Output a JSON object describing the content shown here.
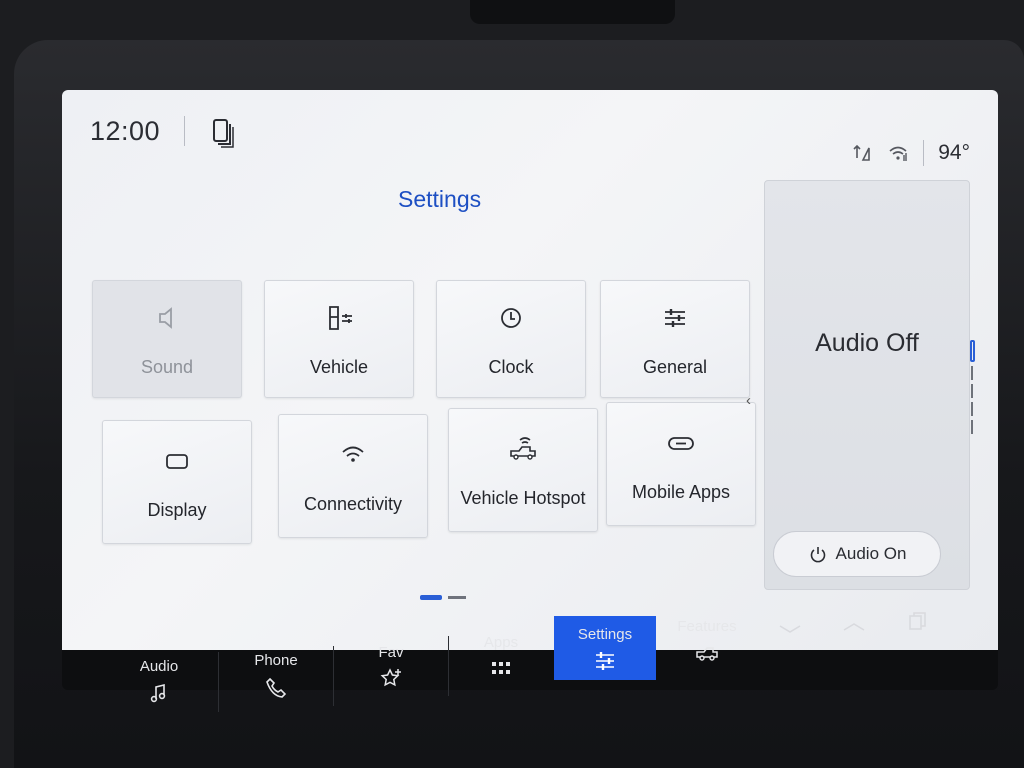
{
  "status": {
    "time": "12:00",
    "temperature": "94°"
  },
  "page": {
    "title": "Settings"
  },
  "tiles": [
    {
      "label": "Sound",
      "icon": "speaker-icon",
      "enabled": false
    },
    {
      "label": "Vehicle",
      "icon": "vehicle-settings-icon",
      "enabled": true
    },
    {
      "label": "Clock",
      "icon": "clock-icon",
      "enabled": true
    },
    {
      "label": "General",
      "icon": "sliders-icon",
      "enabled": true
    },
    {
      "label": "Display",
      "icon": "display-icon",
      "enabled": true
    },
    {
      "label": "Connectivity",
      "icon": "wifi-icon",
      "enabled": true
    },
    {
      "label": "Vehicle Hotspot",
      "icon": "truck-wifi-icon",
      "enabled": true
    },
    {
      "label": "Mobile Apps",
      "icon": "link-icon",
      "enabled": true
    }
  ],
  "audio": {
    "state_text": "Audio Off",
    "button_label": "Audio On"
  },
  "nav": {
    "items": [
      {
        "label": "Audio",
        "icon": "music-note-icon"
      },
      {
        "label": "Phone",
        "icon": "phone-icon"
      },
      {
        "label": "Fav",
        "icon": "star-plus-icon"
      },
      {
        "label": "Apps",
        "icon": "apps-grid-icon"
      },
      {
        "label": "Settings",
        "icon": "settings-sliders-icon",
        "active": true
      },
      {
        "label": "Features",
        "icon": "truck-icon"
      }
    ]
  },
  "colors": {
    "accent": "#1f5be6",
    "title": "#1d4fc3"
  }
}
